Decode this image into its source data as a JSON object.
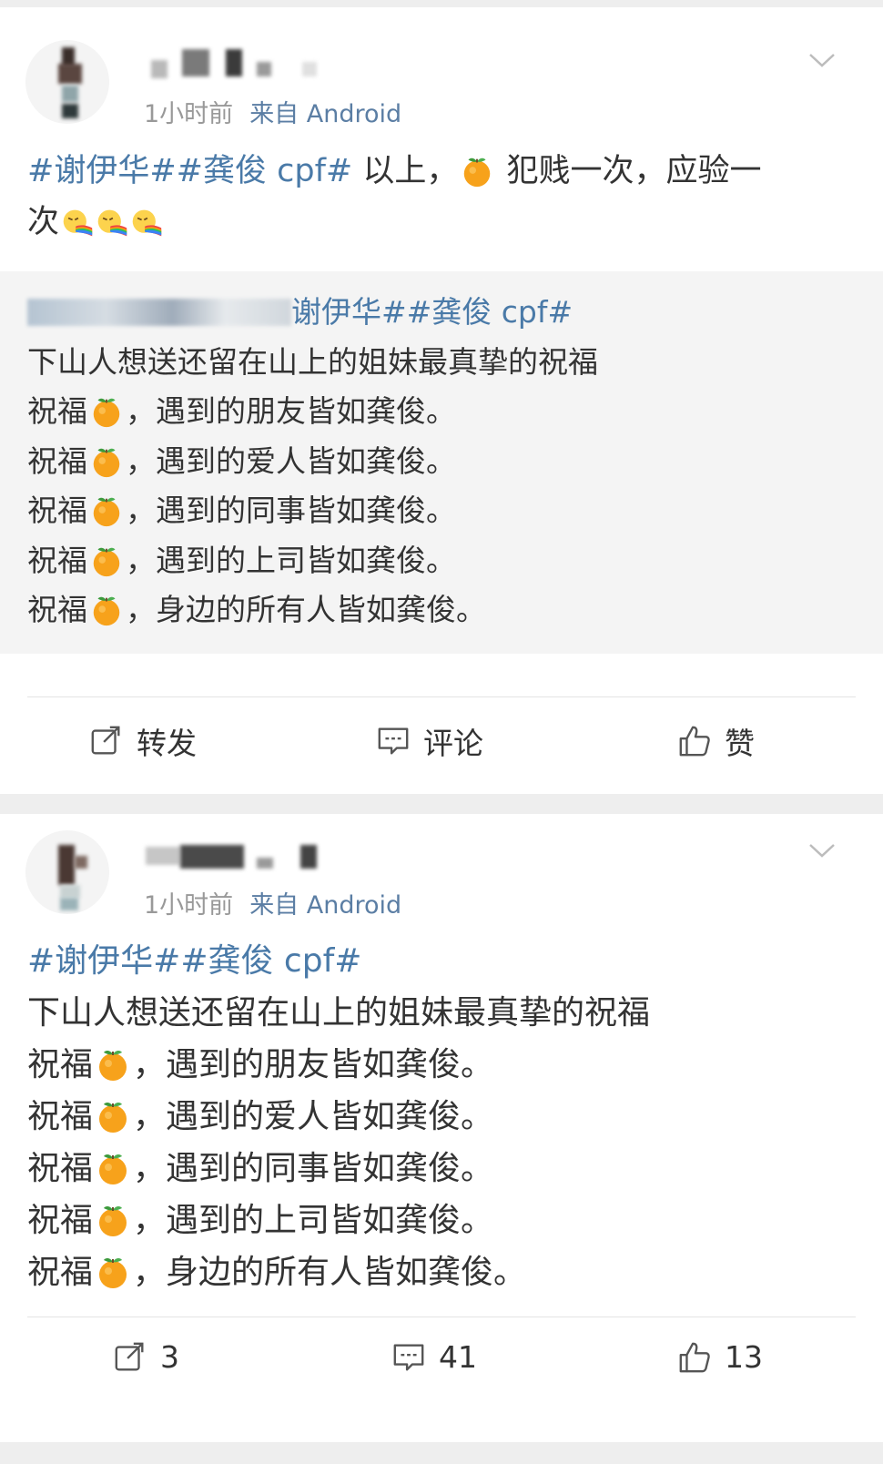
{
  "post1": {
    "meta_time": "1小时前",
    "meta_source": "来自 Android",
    "text_tag": "#谢伊华##龚俊 cpf#",
    "text_body_a": " 以上，",
    "text_body_b": " 犯贱一次，应验一",
    "text_body_c": "次",
    "repost": {
      "mention_tail": "谢伊华##龚俊 cpf#",
      "lines": [
        "下山人想送还留在山上的姐妹最真挚的祝福",
        "，遇到的朋友皆如龚俊。",
        "，遇到的爱人皆如龚俊。",
        "，遇到的同事皆如龚俊。",
        "，遇到的上司皆如龚俊。",
        "，身边的所有人皆如龚俊。"
      ],
      "prefix": "祝福"
    },
    "actions": {
      "repost": "转发",
      "comment": "评论",
      "like": "赞"
    }
  },
  "post2": {
    "meta_time": "1小时前",
    "meta_source": "来自 Android",
    "text_tag": "#谢伊华##龚俊 cpf#",
    "lines": [
      "下山人想送还留在山上的姐妹最真挚的祝福",
      "，遇到的朋友皆如龚俊。",
      "，遇到的爱人皆如龚俊。",
      "，遇到的同事皆如龚俊。",
      "，遇到的上司皆如龚俊。",
      "，身边的所有人皆如龚俊。"
    ],
    "prefix": "祝福",
    "actions": {
      "repost_count": "3",
      "comment_count": "41",
      "like_count": "13"
    }
  },
  "icons": {
    "chevron": "chevron-down-icon",
    "repost": "repost-icon",
    "comment": "comment-icon",
    "like": "thumbs-up-icon",
    "emoji_orange": "tangerine-emoji",
    "emoji_face": "vomit-rainbow-face-emoji"
  },
  "colors": {
    "tag": "#4a7aa8",
    "source": "#5b7ea4",
    "meta": "#999999",
    "repost_bg": "#f4f4f4",
    "page_bg": "#eeeeee"
  }
}
